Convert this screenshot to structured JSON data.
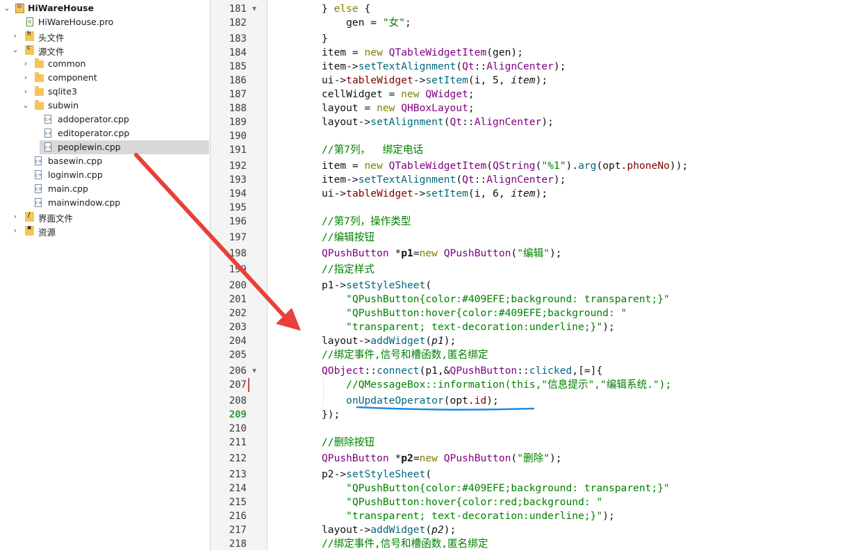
{
  "project_tree": {
    "project_name": "HiWareHouse",
    "items": [
      {
        "label": "HiWareHouse.pro"
      },
      {
        "label": "头文件"
      },
      {
        "label": "源文件"
      },
      {
        "label": "common"
      },
      {
        "label": "component"
      },
      {
        "label": "sqlite3"
      },
      {
        "label": "subwin"
      },
      {
        "label": "addoperator.cpp"
      },
      {
        "label": "editoperator.cpp"
      },
      {
        "label": "peoplewin.cpp"
      },
      {
        "label": "basewin.cpp"
      },
      {
        "label": "loginwin.cpp"
      },
      {
        "label": "main.cpp"
      },
      {
        "label": "mainwindow.cpp"
      },
      {
        "label": "界面文件"
      },
      {
        "label": "资源"
      }
    ],
    "selected_file": "peoplewin.cpp"
  },
  "editor": {
    "current_line": "209",
    "lines": [
      {
        "n": "181",
        "segs": [
          [
            "",
            "} "
          ],
          [
            "kw",
            "else"
          ],
          [
            "",
            " {"
          ]
        ]
      },
      {
        "n": "182",
        "segs": [
          [
            "",
            "    gen = "
          ],
          [
            "st",
            "\"女\""
          ],
          [
            "",
            ";"
          ]
        ]
      },
      {
        "n": "183",
        "segs": [
          [
            "",
            "}"
          ]
        ]
      },
      {
        "n": "184",
        "segs": [
          [
            "",
            "item = "
          ],
          [
            "kw",
            "new"
          ],
          [
            "",
            " "
          ],
          [
            "ty",
            "QTableWidgetItem"
          ],
          [
            "",
            "(gen);"
          ]
        ]
      },
      {
        "n": "185",
        "segs": [
          [
            "",
            "item->"
          ],
          [
            "fn",
            "setTextAlignment"
          ],
          [
            "",
            "("
          ],
          [
            "ty",
            "Qt"
          ],
          [
            "",
            "::"
          ],
          [
            "ty",
            "AlignCenter"
          ],
          [
            "",
            ");"
          ]
        ]
      },
      {
        "n": "186",
        "segs": [
          [
            "",
            "ui->"
          ],
          [
            "mb",
            "tableWidget"
          ],
          [
            "",
            "->"
          ],
          [
            "fn",
            "setItem"
          ],
          [
            "",
            "(i, 5, "
          ],
          [
            "it",
            "item"
          ],
          [
            "",
            ");"
          ]
        ]
      },
      {
        "n": "187",
        "segs": [
          [
            "",
            "cellWidget = "
          ],
          [
            "kw",
            "new"
          ],
          [
            "",
            " "
          ],
          [
            "ty",
            "QWidget"
          ],
          [
            "",
            ";"
          ]
        ]
      },
      {
        "n": "188",
        "segs": [
          [
            "",
            "layout = "
          ],
          [
            "kw",
            "new"
          ],
          [
            "",
            " "
          ],
          [
            "ty",
            "QHBoxLayout"
          ],
          [
            "",
            ";"
          ]
        ]
      },
      {
        "n": "189",
        "segs": [
          [
            "",
            "layout->"
          ],
          [
            "fn",
            "setAlignment"
          ],
          [
            "",
            "("
          ],
          [
            "ty",
            "Qt"
          ],
          [
            "",
            "::"
          ],
          [
            "ty",
            "AlignCenter"
          ],
          [
            "",
            ");"
          ]
        ]
      },
      {
        "n": "190",
        "segs": []
      },
      {
        "n": "191",
        "segs": [
          [
            "cm",
            "//第7列，  绑定电话"
          ]
        ]
      },
      {
        "n": "192",
        "segs": [
          [
            "",
            "item = "
          ],
          [
            "kw",
            "new"
          ],
          [
            "",
            " "
          ],
          [
            "ty",
            "QTableWidgetItem"
          ],
          [
            "",
            "("
          ],
          [
            "ty",
            "QString"
          ],
          [
            "",
            "("
          ],
          [
            "st",
            "\"%1\""
          ],
          [
            "",
            ")."
          ],
          [
            "fn",
            "arg"
          ],
          [
            "",
            "(opt."
          ],
          [
            "mb",
            "phoneNo"
          ],
          [
            "",
            "));"
          ]
        ]
      },
      {
        "n": "193",
        "segs": [
          [
            "",
            "item->"
          ],
          [
            "fn",
            "setTextAlignment"
          ],
          [
            "",
            "("
          ],
          [
            "ty",
            "Qt"
          ],
          [
            "",
            "::"
          ],
          [
            "ty",
            "AlignCenter"
          ],
          [
            "",
            ");"
          ]
        ]
      },
      {
        "n": "194",
        "segs": [
          [
            "",
            "ui->"
          ],
          [
            "mb",
            "tableWidget"
          ],
          [
            "",
            "->"
          ],
          [
            "fn",
            "setItem"
          ],
          [
            "",
            "(i, 6, "
          ],
          [
            "it",
            "item"
          ],
          [
            "",
            ");"
          ]
        ]
      },
      {
        "n": "195",
        "segs": []
      },
      {
        "n": "196",
        "segs": [
          [
            "cm",
            "//第7列，操作类型"
          ]
        ]
      },
      {
        "n": "197",
        "segs": [
          [
            "cm",
            "//编辑按钮"
          ]
        ]
      },
      {
        "n": "198",
        "segs": [
          [
            "ty",
            "QPushButton"
          ],
          [
            "",
            " *"
          ],
          [
            "bd",
            "p1"
          ],
          [
            "",
            "="
          ],
          [
            "kw",
            "new"
          ],
          [
            "",
            " "
          ],
          [
            "ty",
            "QPushButton"
          ],
          [
            "",
            "("
          ],
          [
            "st",
            "\"编辑\""
          ],
          [
            "",
            ");"
          ]
        ]
      },
      {
        "n": "199",
        "segs": [
          [
            "cm",
            "//指定样式"
          ]
        ]
      },
      {
        "n": "200",
        "segs": [
          [
            "",
            "p1->"
          ],
          [
            "fn",
            "setStyleSheet"
          ],
          [
            "",
            "("
          ]
        ]
      },
      {
        "n": "201",
        "segs": [
          [
            "",
            "    "
          ],
          [
            "st",
            "\"QPushButton{color:#409EFE;background: transparent;}\""
          ]
        ]
      },
      {
        "n": "202",
        "segs": [
          [
            "",
            "    "
          ],
          [
            "st",
            "\"QPushButton:hover{color:#409EFE;background: \""
          ]
        ]
      },
      {
        "n": "203",
        "segs": [
          [
            "",
            "    "
          ],
          [
            "st",
            "\"transparent; text-decoration:underline;}\""
          ],
          [
            "",
            ");"
          ]
        ]
      },
      {
        "n": "204",
        "segs": [
          [
            "",
            "layout->"
          ],
          [
            "fn",
            "addWidget"
          ],
          [
            "",
            "("
          ],
          [
            "it",
            "p1"
          ],
          [
            "",
            ");"
          ]
        ]
      },
      {
        "n": "205",
        "segs": [
          [
            "cm",
            "//绑定事件,信号和槽函数,匿名绑定"
          ]
        ]
      },
      {
        "n": "206",
        "segs": [
          [
            "ty",
            "QObject"
          ],
          [
            "",
            "::"
          ],
          [
            "fn",
            "connect"
          ],
          [
            "",
            "(p1,&"
          ],
          [
            "ty",
            "QPushButton"
          ],
          [
            "",
            "::"
          ],
          [
            "fn",
            "clicked"
          ],
          [
            "",
            ",[=]{"
          ]
        ]
      },
      {
        "n": "207",
        "segs": [
          [
            "",
            "    "
          ],
          [
            "cm",
            "//QMessageBox::information(this,\"信息提示\",\"编辑系统.\");"
          ]
        ]
      },
      {
        "n": "208",
        "segs": [
          [
            "",
            "    "
          ],
          [
            "fn",
            "onUpdateOperator"
          ],
          [
            "",
            "(opt."
          ],
          [
            "mb",
            "id"
          ],
          [
            "",
            ");"
          ]
        ]
      },
      {
        "n": "209",
        "segs": [
          [
            "",
            "});"
          ]
        ]
      },
      {
        "n": "210",
        "segs": []
      },
      {
        "n": "211",
        "segs": [
          [
            "cm",
            "//删除按钮"
          ]
        ]
      },
      {
        "n": "212",
        "segs": [
          [
            "ty",
            "QPushButton"
          ],
          [
            "",
            " *"
          ],
          [
            "bd",
            "p2"
          ],
          [
            "",
            "="
          ],
          [
            "kw",
            "new"
          ],
          [
            "",
            " "
          ],
          [
            "ty",
            "QPushButton"
          ],
          [
            "",
            "("
          ],
          [
            "st",
            "\"删除\""
          ],
          [
            "",
            ");"
          ]
        ]
      },
      {
        "n": "213",
        "segs": [
          [
            "",
            "p2->"
          ],
          [
            "fn",
            "setStyleSheet"
          ],
          [
            "",
            "("
          ]
        ]
      },
      {
        "n": "214",
        "segs": [
          [
            "",
            "    "
          ],
          [
            "st",
            "\"QPushButton{color:#409EFE;background: transparent;}\""
          ]
        ]
      },
      {
        "n": "215",
        "segs": [
          [
            "",
            "    "
          ],
          [
            "st",
            "\"QPushButton:hover{color:red;background: \""
          ]
        ]
      },
      {
        "n": "216",
        "segs": [
          [
            "",
            "    "
          ],
          [
            "st",
            "\"transparent; text-decoration:underline;}\""
          ],
          [
            "",
            ");"
          ]
        ]
      },
      {
        "n": "217",
        "segs": [
          [
            "",
            "layout->"
          ],
          [
            "fn",
            "addWidget"
          ],
          [
            "",
            "("
          ],
          [
            "it",
            "p2"
          ],
          [
            "",
            ");"
          ]
        ]
      },
      {
        "n": "218",
        "segs": [
          [
            "cm",
            "//绑定事件,信号和槽函数,匿名绑定"
          ]
        ]
      }
    ]
  },
  "annotation": {
    "arrow_color": "#e8403a",
    "underline_color": "#1a8ae8"
  }
}
